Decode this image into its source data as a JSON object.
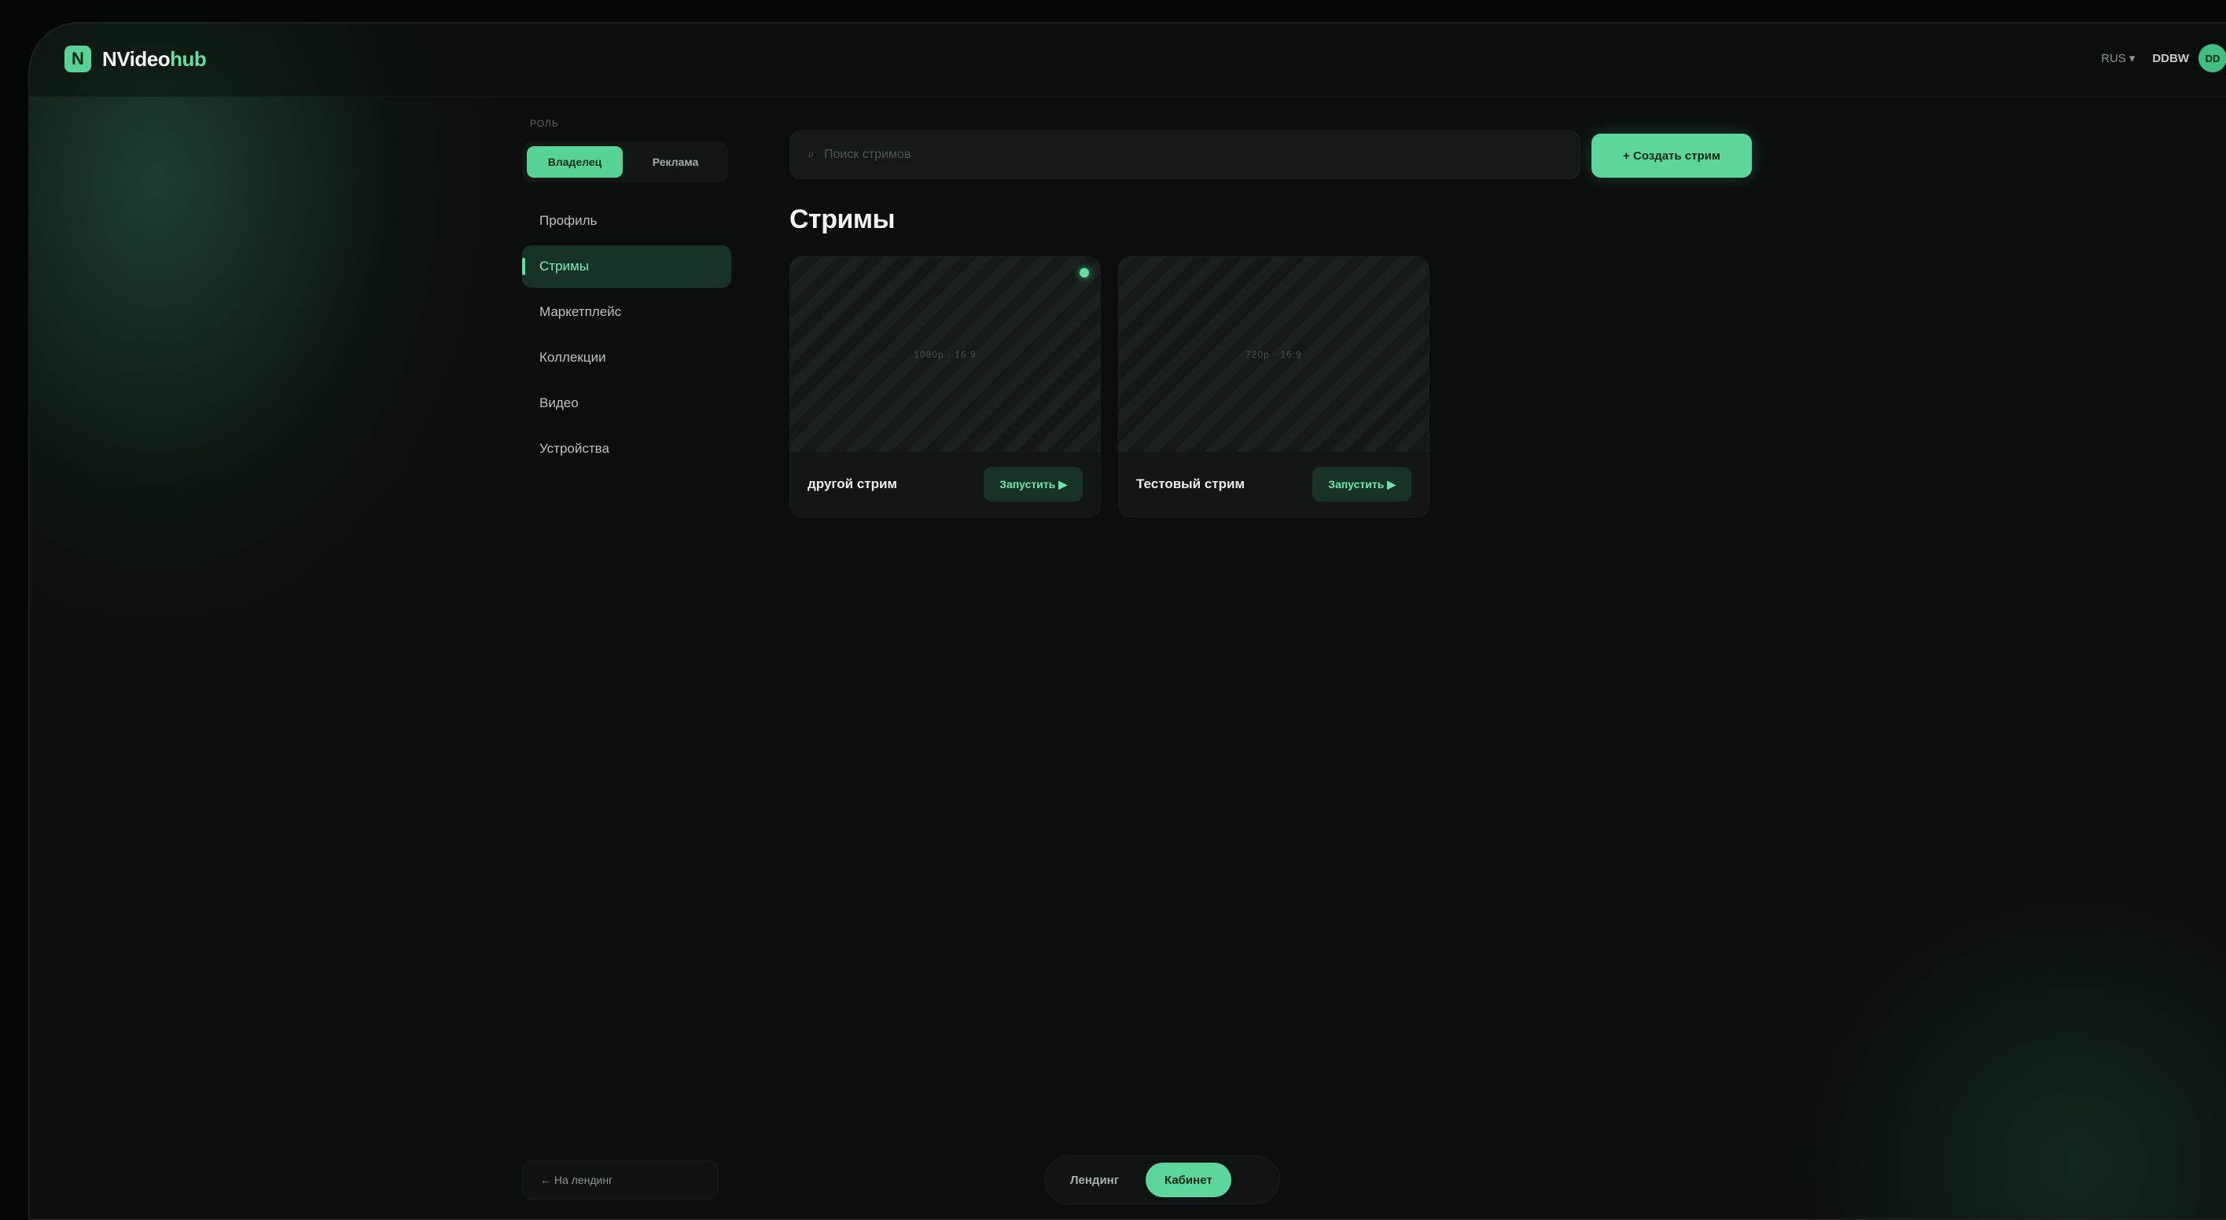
{
  "brand": {
    "mark": "N",
    "name_main": "NVideo",
    "name_accent": "hub"
  },
  "header": {
    "language": "RUS",
    "language_caret": "▾",
    "username": "DDBW",
    "avatar_initials": "DD"
  },
  "sidebar": {
    "role_label": "Роль",
    "roles": [
      {
        "label": "Владелец",
        "active": true
      },
      {
        "label": "Реклама",
        "active": false
      }
    ],
    "items": [
      {
        "label": "Профиль",
        "active": false
      },
      {
        "label": "Стримы",
        "active": true
      },
      {
        "label": "Маркетплейс",
        "active": false
      },
      {
        "label": "Коллекции",
        "active": false
      },
      {
        "label": "Видео",
        "active": false
      },
      {
        "label": "Устройства",
        "active": false
      }
    ],
    "back_link": "← На лендинг"
  },
  "search": {
    "placeholder": "Поиск стримов",
    "value": ""
  },
  "create_button": "+ Создать стрим",
  "page_title": "Стримы",
  "streams": [
    {
      "title": "другой стрим",
      "preview_meta": "1080p · 16:9",
      "live": true,
      "action": "Запустить ▶"
    },
    {
      "title": "Тестовый стрим",
      "preview_meta": "720p · 16:9",
      "live": false,
      "action": "Запустить ▶"
    }
  ],
  "bottom_toggle": [
    {
      "label": "Лендинг",
      "active": false
    },
    {
      "label": "Кабинет",
      "active": true
    }
  ],
  "colors": {
    "accent": "#5cd69b",
    "background": "#0b0e0d",
    "active_nav_bg": "#173327"
  }
}
